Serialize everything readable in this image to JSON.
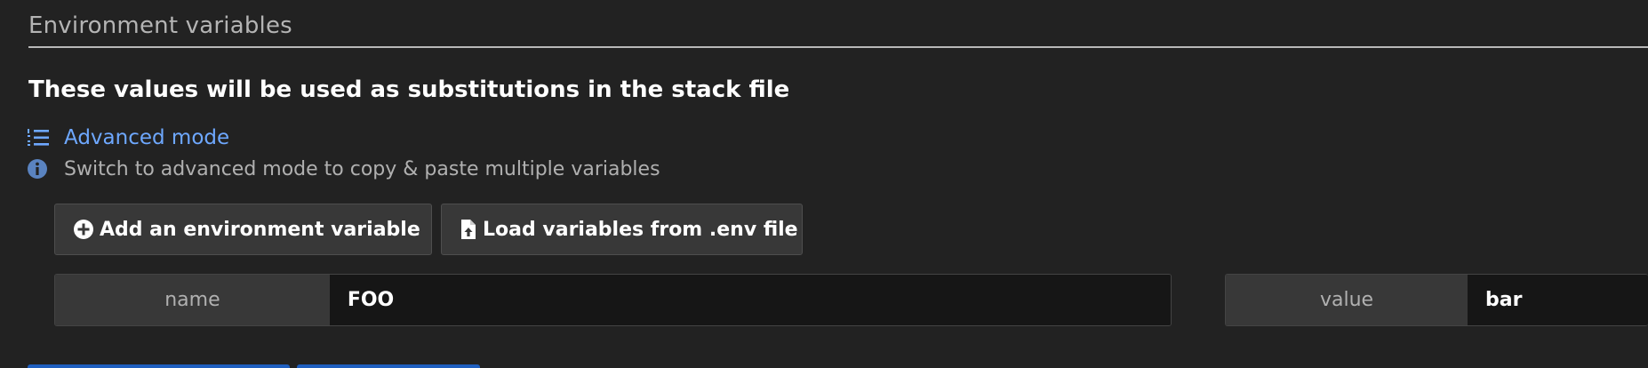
{
  "section": {
    "title": "Environment variables"
  },
  "description": "These values will be used as substitutions in the stack file",
  "advanced_mode": {
    "label": "Advanced mode",
    "icon": "list-ordered-icon",
    "hint_icon": "info-icon",
    "hint": "Switch to advanced mode to copy & paste multiple variables"
  },
  "actions": {
    "add_label": "Add an environment variable",
    "add_icon": "plus-circle-icon",
    "load_label": "Load variables from .env file",
    "load_icon": "file-upload-icon"
  },
  "variables": [
    {
      "name_addon": "name",
      "name_value": "FOO",
      "value_addon": "value",
      "value_value": "bar"
    }
  ],
  "colors": {
    "background": "#222222",
    "link": "#6ea8ff",
    "primary": "#1f5fbf"
  }
}
